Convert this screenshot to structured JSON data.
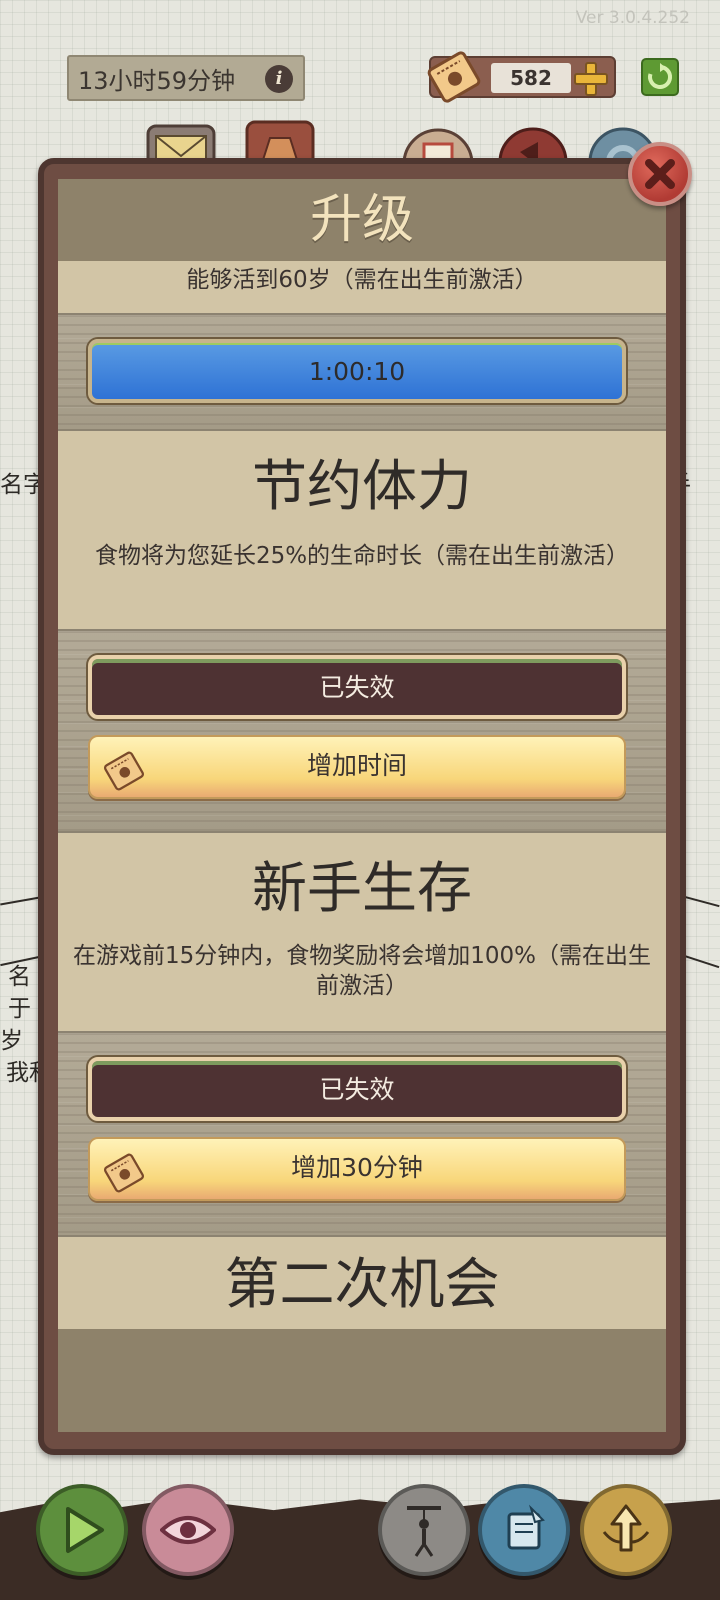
{
  "header": {
    "version": "Ver 3.0.4.252",
    "timer": "13小时59分钟",
    "info_icon": "i",
    "currency": "582"
  },
  "background": {
    "left_lines": [
      "名字",
      "名",
      "于",
      "岁",
      "我和"
    ],
    "right_lines": [
      "手"
    ]
  },
  "modal": {
    "title": "升级",
    "sections": [
      {
        "description": "能够活到60岁（需在出生前激活）",
        "timer_bar": "1:00:10"
      },
      {
        "title": "节约体力",
        "description": "食物将为您延长25%的生命时长（需在出生前激活）",
        "status_button": "已失效",
        "action_button": "增加时间"
      },
      {
        "title": "新手生存",
        "description": "在游戏前15分钟内，食物奖励将会增加100%（需在出生前激活）",
        "status_button": "已失效",
        "action_button": "增加30分钟"
      },
      {
        "title": "第二次机会"
      }
    ]
  },
  "icons": {
    "info": "info-icon",
    "ticket": "ticket-icon",
    "plus": "plus-icon",
    "refresh": "refresh-icon",
    "close": "close-icon",
    "mail": "mail-icon",
    "shop": "shop-icon",
    "calendar": "calendar-icon",
    "megaphone": "megaphone-icon",
    "settings": "gear-icon",
    "play": "play-icon",
    "eye": "eye-icon",
    "puppet": "puppet-icon",
    "scroll": "scroll-icon",
    "upgrade": "upgrade-icon"
  },
  "colors": {
    "timer_bar": "#3b7ed6",
    "expired_button": "#4e3233",
    "action_button": "#f8d67a",
    "close_button": "#c0433b",
    "play_button": "#5d8f3d",
    "eye_button": "#c98b98",
    "puppet_button": "#8d8a86",
    "scroll_button": "#4f88a7",
    "upgrade_button": "#c7a14c"
  }
}
